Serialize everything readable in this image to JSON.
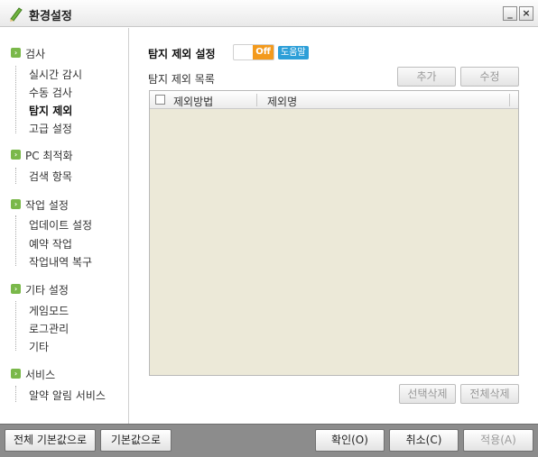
{
  "window": {
    "title": "환경설정",
    "minimize": "_",
    "close": "×"
  },
  "sidebar": {
    "categories": [
      {
        "label": "검사",
        "items": [
          "실시간 감시",
          "수동 검사",
          "탐지 제외",
          "고급 설정"
        ]
      },
      {
        "label": "PC 최적화",
        "items": [
          "검색 항목"
        ]
      },
      {
        "label": "작업 설정",
        "items": [
          "업데이트 설정",
          "예약 작업",
          "작업내역 복구"
        ]
      },
      {
        "label": "기타 설정",
        "items": [
          "게임모드",
          "로그관리",
          "기타"
        ]
      },
      {
        "label": "서비스",
        "items": [
          "알약 알림 서비스"
        ]
      }
    ],
    "active_item": "탐지 제외"
  },
  "main": {
    "section_title": "탐지 제외 설정",
    "toggle_state": "Off",
    "help_label": "도움말",
    "list_title": "탐지 제외 목록",
    "add_button": "추가",
    "edit_button": "수정",
    "columns": [
      "제외방법",
      "제외명"
    ],
    "rows": [],
    "delete_selected_button": "선택삭제",
    "delete_all_button": "전체삭제"
  },
  "footer": {
    "reset_all": "전체 기본값으로",
    "reset": "기본값으로",
    "ok": "확인(O)",
    "cancel": "취소(C)",
    "apply": "적용(A)"
  },
  "colors": {
    "toggle_off": "#f39a1d",
    "help_badge": "#2d9fd8",
    "category_icon": "#7ab84a",
    "table_bg": "#ece9d8",
    "footer_bg": "#8c8c8c"
  }
}
